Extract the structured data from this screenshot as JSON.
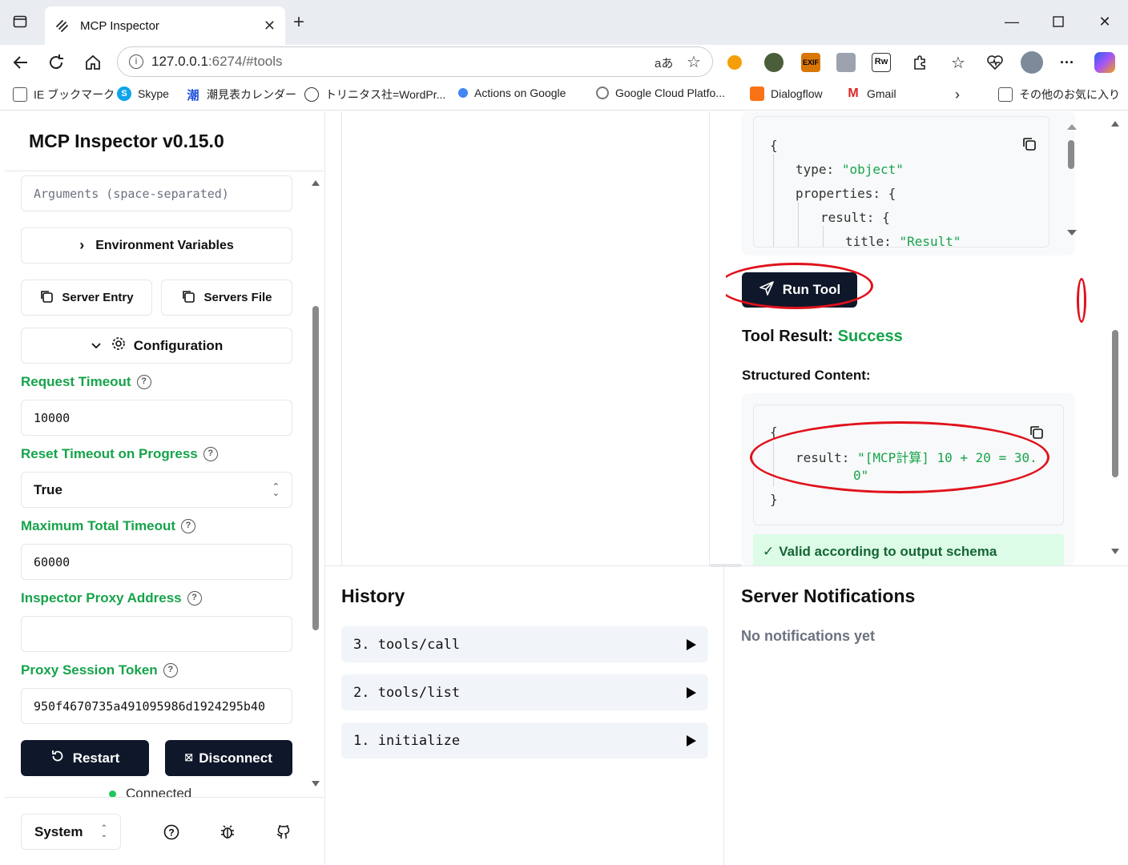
{
  "browser": {
    "tab_title": "MCP Inspector",
    "url_host": "127.0.0.1",
    "url_rest": ":6274/#tools",
    "bookmarks": [
      {
        "label": "IE ブックマーク",
        "icon": "folder-icon"
      },
      {
        "label": "Skype",
        "icon": "skype-icon"
      },
      {
        "label": "潮見表カレンダー",
        "icon": "tide-icon"
      },
      {
        "label": "トリニタス社=WordPr...",
        "icon": "globe-icon"
      },
      {
        "label": "Actions on Google",
        "icon": "google-assistant-icon"
      },
      {
        "label": "Google Cloud Platfo...",
        "icon": "gcp-icon"
      },
      {
        "label": "Dialogflow",
        "icon": "dialogflow-icon"
      },
      {
        "label": "Gmail",
        "icon": "gmail-icon"
      }
    ],
    "other_favorites": "その他のお気に入り"
  },
  "sidebar": {
    "title": "MCP Inspector v0.15.0",
    "arguments_placeholder": "Arguments (space-separated)",
    "env_vars_label": "Environment Variables",
    "server_entry_label": "Server Entry",
    "servers_file_label": "Servers File",
    "configuration_label": "Configuration",
    "request_timeout_label": "Request Timeout",
    "request_timeout_value": "10000",
    "reset_timeout_label": "Reset Timeout on Progress",
    "reset_timeout_value": "True",
    "max_total_timeout_label": "Maximum Total Timeout",
    "max_total_timeout_value": "60000",
    "proxy_address_label": "Inspector Proxy Address",
    "proxy_address_value": "",
    "session_token_label": "Proxy Session Token",
    "session_token_value": "950f4670735a491095986d1924295b40",
    "restart_label": "Restart",
    "disconnect_label": "Disconnect",
    "status_text": "Connected",
    "theme_value": "System"
  },
  "tool_detail": {
    "schema_lines": [
      {
        "key": "",
        "value": "{",
        "indent": 0
      },
      {
        "key": "type:",
        "value": "\"object\"",
        "indent": 1
      },
      {
        "key": "properties:",
        "value": "{",
        "indent": 1
      },
      {
        "key": "result:",
        "value": "{",
        "indent": 2
      },
      {
        "key": "title:",
        "value": "\"Result\"",
        "indent": 3
      }
    ],
    "run_tool_label": "Run Tool",
    "result_heading": "Tool Result:",
    "result_status": "Success",
    "structured_heading": "Structured Content:",
    "structured_open": "{",
    "structured_key": "result:",
    "structured_value_line1": "\"[MCP計算] 10 + 20 = 30.",
    "structured_value_line2": "0\"",
    "structured_close": "}",
    "valid_text": "Valid according to output schema"
  },
  "history": {
    "title": "History",
    "items": [
      {
        "label": "3. tools/call"
      },
      {
        "label": "2. tools/list"
      },
      {
        "label": "1. initialize"
      }
    ]
  },
  "notifications": {
    "title": "Server Notifications",
    "empty_text": "No notifications yet"
  },
  "colors": {
    "accent_green": "#16a34a",
    "dark_button": "#0f172a",
    "annotation_red": "#e0111b"
  }
}
